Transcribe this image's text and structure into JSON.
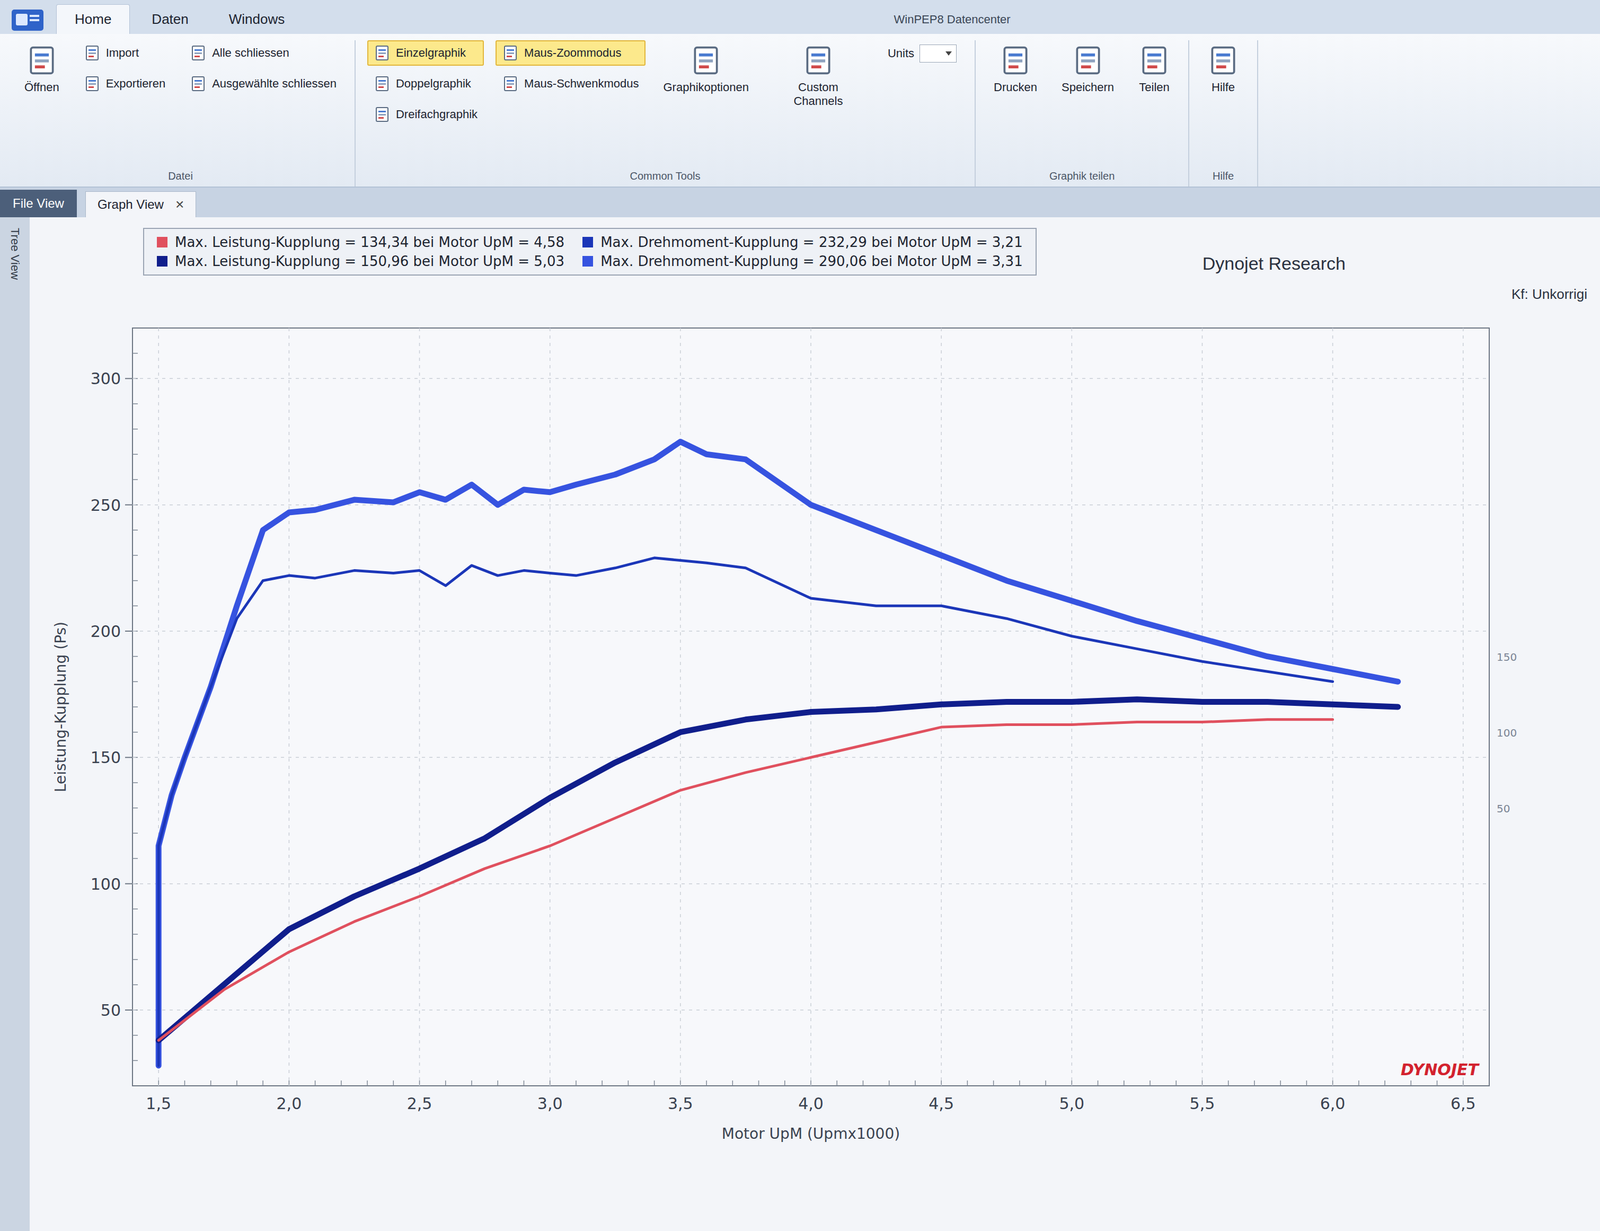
{
  "window": {
    "title": "WinPEP8 Datencenter"
  },
  "tabs": [
    {
      "label": "Home",
      "selected": true
    },
    {
      "label": "Daten",
      "selected": false
    },
    {
      "label": "Windows",
      "selected": false
    }
  ],
  "ribbon": {
    "groups": [
      {
        "label": "Datei",
        "columns": [
          [
            {
              "label": "Öffnen",
              "kind": "large",
              "selected": false
            }
          ],
          [
            {
              "label": "Import",
              "kind": "small",
              "selected": false
            },
            {
              "label": "Exportieren",
              "kind": "small",
              "selected": false
            }
          ],
          [
            {
              "label": "Alle schliessen",
              "kind": "small",
              "selected": false
            },
            {
              "label": "Ausgewählte schliessen",
              "kind": "small",
              "selected": false
            }
          ]
        ]
      },
      {
        "label": "Common Tools",
        "columns": [
          [
            {
              "label": "Einzelgraphik",
              "kind": "small",
              "selected": true
            },
            {
              "label": "Doppelgraphik",
              "kind": "small",
              "selected": false
            },
            {
              "label": "Dreifachgraphik",
              "kind": "small",
              "selected": false
            }
          ],
          [
            {
              "label": "Maus-Zoommodus",
              "kind": "small",
              "selected": true
            },
            {
              "label": "Maus-Schwenkmodus",
              "kind": "small",
              "selected": false
            }
          ],
          [
            {
              "label": "Graphikoptionen",
              "kind": "large",
              "selected": false
            }
          ],
          [
            {
              "label": "Custom Channels",
              "kind": "large",
              "selected": false
            }
          ],
          [
            {
              "label": "Units",
              "kind": "dropdown",
              "selected": false
            }
          ]
        ]
      },
      {
        "label": "Graphik teilen",
        "columns": [
          [
            {
              "label": "Drucken",
              "kind": "large",
              "selected": false
            }
          ],
          [
            {
              "label": "Speichern",
              "kind": "large",
              "selected": false
            }
          ],
          [
            {
              "label": "Teilen",
              "kind": "large",
              "selected": false
            }
          ]
        ]
      },
      {
        "label": "Hilfe",
        "columns": [
          [
            {
              "label": "Hilfe",
              "kind": "large",
              "selected": false
            }
          ]
        ]
      }
    ]
  },
  "panels": {
    "file_view": "File View",
    "tree_view": "Tree View"
  },
  "doc_tabs": [
    {
      "label": "Graph View",
      "selected": true,
      "close": "×"
    }
  ],
  "chart": {
    "title": "Dynojet Research",
    "correction": "Kf: Unkorrigi",
    "logo": "DYNOJET",
    "y_axis": {
      "label": "Leistung-Kupplung (Ps)",
      "ticks": [
        "300",
        "250",
        "200",
        "150",
        "100",
        "50"
      ]
    },
    "x_axis": {
      "label": "Motor UpM (Upmx1000)",
      "ticks": [
        "1,5",
        "2,0",
        "2,5",
        "3,0",
        "3,5",
        "4,0",
        "4,5",
        "5,0",
        "5,5",
        "6,0",
        "6,5"
      ]
    },
    "right_ticks": [
      "150",
      "100",
      "50"
    ],
    "legend": [
      {
        "text": "Max. Leistung-Kupplung = 134,34 bei Motor UpM = 4,58",
        "color": "#e0505e"
      },
      {
        "text": "Max. Leistung-Kupplung = 150,96 bei Motor UpM = 5,03",
        "color": "#101e8c"
      },
      {
        "text": "Max. Drehmoment-Kupplung = 232,29 bei Motor UpM = 3,21",
        "color": "#1b36b8"
      },
      {
        "text": "Max. Drehmoment-Kupplung = 290,06 bei Motor UpM = 3,31",
        "color": "#3653e0"
      }
    ],
    "series": [
      {
        "name": "torque-290",
        "color": "#3653e0",
        "kind": "thick",
        "rpm": [
          1.5,
          1.5,
          1.55,
          1.6,
          1.7,
          1.8,
          1.9,
          2.0,
          2.1,
          2.25,
          2.4,
          2.5,
          2.6,
          2.7,
          2.8,
          2.9,
          3.0,
          3.1,
          3.25,
          3.4,
          3.5,
          3.6,
          3.75,
          4.0,
          4.25,
          4.5,
          4.75,
          5.0,
          5.25,
          5.5,
          5.75,
          6.0,
          6.25
        ],
        "values": [
          28,
          115,
          135,
          150,
          178,
          210,
          240,
          247,
          248,
          252,
          251,
          255,
          252,
          258,
          250,
          256,
          255,
          258,
          262,
          268,
          275,
          270,
          268,
          250,
          240,
          230,
          220,
          212,
          204,
          197,
          190,
          185,
          180
        ]
      },
      {
        "name": "torque-232",
        "color": "#1b36b8",
        "kind": "thin",
        "rpm": [
          1.5,
          1.5,
          1.55,
          1.6,
          1.7,
          1.8,
          1.9,
          2.0,
          2.1,
          2.25,
          2.4,
          2.5,
          2.6,
          2.7,
          2.8,
          2.9,
          3.0,
          3.1,
          3.25,
          3.4,
          3.5,
          3.6,
          3.75,
          4.0,
          4.25,
          4.5,
          4.75,
          5.0,
          5.25,
          5.5,
          5.75,
          6.0
        ],
        "values": [
          28,
          115,
          135,
          150,
          178,
          205,
          220,
          222,
          221,
          224,
          223,
          224,
          218,
          226,
          222,
          224,
          223,
          222,
          225,
          229,
          228,
          227,
          225,
          213,
          210,
          210,
          205,
          198,
          193,
          188,
          184,
          180
        ]
      },
      {
        "name": "power-150",
        "color": "#101e8c",
        "kind": "thick",
        "rpm": [
          1.5,
          1.75,
          2.0,
          2.25,
          2.5,
          2.75,
          3.0,
          3.25,
          3.5,
          3.75,
          4.0,
          4.25,
          4.5,
          4.75,
          5.0,
          5.25,
          5.5,
          5.75,
          6.0,
          6.25
        ],
        "values": [
          38,
          60,
          82,
          95,
          106,
          118,
          134,
          148,
          160,
          165,
          168,
          169,
          171,
          172,
          172,
          173,
          172,
          172,
          171,
          170
        ]
      },
      {
        "name": "power-134",
        "color": "#e0505e",
        "kind": "thin",
        "rpm": [
          1.5,
          1.75,
          2.0,
          2.25,
          2.5,
          2.75,
          3.0,
          3.25,
          3.5,
          3.75,
          4.0,
          4.25,
          4.5,
          4.75,
          5.0,
          5.25,
          5.5,
          5.75,
          6.0
        ],
        "values": [
          38,
          58,
          73,
          85,
          95,
          106,
          115,
          126,
          137,
          144,
          150,
          156,
          162,
          163,
          163,
          164,
          164,
          165,
          165
        ]
      }
    ]
  }
}
